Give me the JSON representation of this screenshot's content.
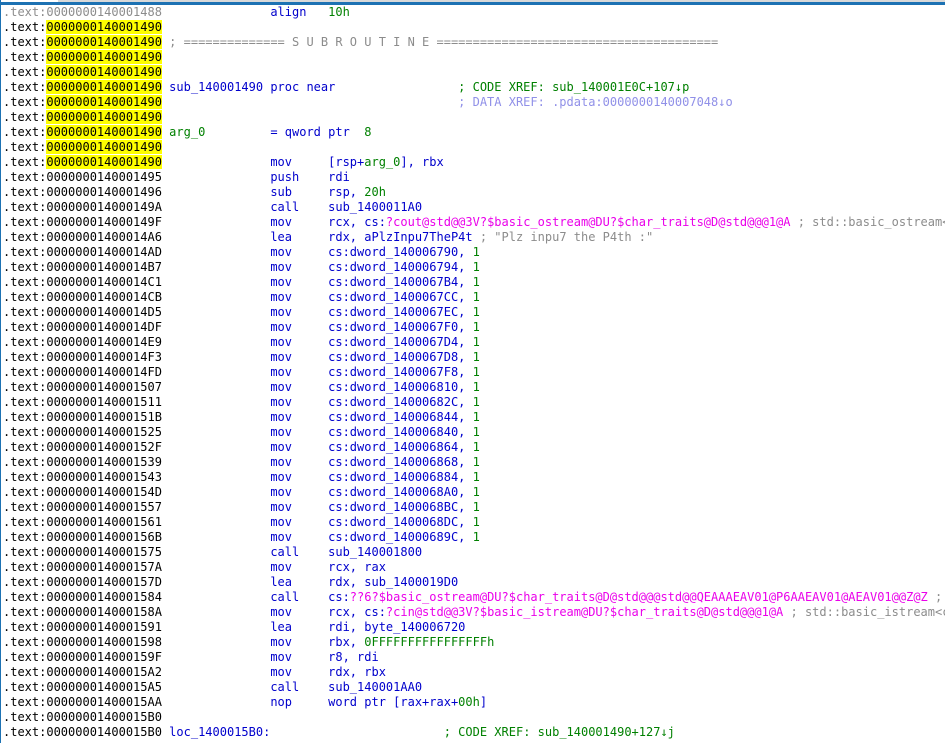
{
  "colors": {
    "focus_blue": "#1d72b3",
    "sliver_gray": "#d9d9d9",
    "addr_black": "#000000",
    "dim_gray": "#8c8c8c",
    "highlight_yellow": "#ffff00",
    "code_blue": "#0000cc",
    "number_green": "#008000",
    "import_magenta": "#ea00ea",
    "dataxref_lavender": "#9090e8"
  },
  "view": {
    "segment_name": ".text",
    "current_address": "0000000140001490",
    "function_name": "sub_140001490"
  },
  "listing": {
    "lines": [
      {
        "segs": [
          [
            "d",
            ".text:0000000140001488"
          ],
          [
            "b",
            "               align   "
          ],
          [
            "g",
            "10h"
          ]
        ]
      },
      {
        "segs": [
          [
            "k",
            ".text:"
          ],
          [
            "hl",
            "0000000140001490"
          ]
        ]
      },
      {
        "segs": [
          [
            "k",
            ".text:"
          ],
          [
            "hl",
            "0000000140001490"
          ],
          [
            "d",
            " ; ============== S U B R O U T I N E ======================================="
          ]
        ]
      },
      {
        "segs": [
          [
            "k",
            ".text:"
          ],
          [
            "hl",
            "0000000140001490"
          ]
        ]
      },
      {
        "segs": [
          [
            "k",
            ".text:"
          ],
          [
            "hl",
            "0000000140001490"
          ]
        ]
      },
      {
        "segs": [
          [
            "k",
            ".text:"
          ],
          [
            "hl",
            "0000000140001490"
          ],
          [
            "b",
            " sub_140001490 proc near"
          ],
          [
            "g",
            "                 ; CODE XREF: sub_140001E0C+107↓p"
          ]
        ]
      },
      {
        "segs": [
          [
            "k",
            ".text:"
          ],
          [
            "hl",
            "0000000140001490"
          ],
          [
            "cl",
            "                                         ; DATA XREF: .pdata:0000000140007048↓o"
          ]
        ]
      },
      {
        "segs": [
          [
            "k",
            ".text:"
          ],
          [
            "hl",
            "0000000140001490"
          ]
        ]
      },
      {
        "segs": [
          [
            "k",
            ".text:"
          ],
          [
            "hl",
            "0000000140001490"
          ],
          [
            "g",
            " arg_0"
          ],
          [
            "b",
            "         = qword ptr"
          ],
          [
            "g",
            "  8"
          ]
        ]
      },
      {
        "segs": [
          [
            "k",
            ".text:"
          ],
          [
            "hl",
            "0000000140001490"
          ]
        ]
      },
      {
        "segs": [
          [
            "k",
            ".text:"
          ],
          [
            "hl",
            "0000000140001490"
          ],
          [
            "b",
            "               mov     [rsp+"
          ],
          [
            "g",
            "arg_0"
          ],
          [
            "b",
            "], rbx"
          ]
        ]
      },
      {
        "segs": [
          [
            "k",
            ".text:0000000140001495"
          ],
          [
            "b",
            "               push    rdi"
          ]
        ]
      },
      {
        "segs": [
          [
            "k",
            ".text:0000000140001496"
          ],
          [
            "b",
            "               sub     rsp, "
          ],
          [
            "g",
            "20h"
          ]
        ]
      },
      {
        "segs": [
          [
            "k",
            ".text:000000014000149A"
          ],
          [
            "b",
            "               call    sub_1400011A0"
          ]
        ]
      },
      {
        "segs": [
          [
            "k",
            ".text:000000014000149F"
          ],
          [
            "b",
            "               mov     rcx, cs:"
          ],
          [
            "p",
            "?cout@std@@3V?$basic_ostream@DU?$char_traits@D@std@@@1@A"
          ],
          [
            "d",
            " ; std::basic_ostream<cha"
          ]
        ]
      },
      {
        "segs": [
          [
            "k",
            ".text:00000001400014A6"
          ],
          [
            "b",
            "               lea     rdx, aPlzInpu7TheP4t"
          ],
          [
            "d",
            " ; \"Plz inpu7 the P4th :\""
          ]
        ]
      },
      {
        "segs": [
          [
            "k",
            ".text:00000001400014AD"
          ],
          [
            "b",
            "               mov     cs:dword_140006790, "
          ],
          [
            "g",
            "1"
          ]
        ]
      },
      {
        "segs": [
          [
            "k",
            ".text:00000001400014B7"
          ],
          [
            "b",
            "               mov     cs:dword_140006794, "
          ],
          [
            "g",
            "1"
          ]
        ]
      },
      {
        "segs": [
          [
            "k",
            ".text:00000001400014C1"
          ],
          [
            "b",
            "               mov     cs:dword_1400067B4, "
          ],
          [
            "g",
            "1"
          ]
        ]
      },
      {
        "segs": [
          [
            "k",
            ".text:00000001400014CB"
          ],
          [
            "b",
            "               mov     cs:dword_1400067CC, "
          ],
          [
            "g",
            "1"
          ]
        ]
      },
      {
        "segs": [
          [
            "k",
            ".text:00000001400014D5"
          ],
          [
            "b",
            "               mov     cs:dword_1400067EC, "
          ],
          [
            "g",
            "1"
          ]
        ]
      },
      {
        "segs": [
          [
            "k",
            ".text:00000001400014DF"
          ],
          [
            "b",
            "               mov     cs:dword_1400067F0, "
          ],
          [
            "g",
            "1"
          ]
        ]
      },
      {
        "segs": [
          [
            "k",
            ".text:00000001400014E9"
          ],
          [
            "b",
            "               mov     cs:dword_1400067D4, "
          ],
          [
            "g",
            "1"
          ]
        ]
      },
      {
        "segs": [
          [
            "k",
            ".text:00000001400014F3"
          ],
          [
            "b",
            "               mov     cs:dword_1400067D8, "
          ],
          [
            "g",
            "1"
          ]
        ]
      },
      {
        "segs": [
          [
            "k",
            ".text:00000001400014FD"
          ],
          [
            "b",
            "               mov     cs:dword_1400067F8, "
          ],
          [
            "g",
            "1"
          ]
        ]
      },
      {
        "segs": [
          [
            "k",
            ".text:0000000140001507"
          ],
          [
            "b",
            "               mov     cs:dword_140006810, "
          ],
          [
            "g",
            "1"
          ]
        ]
      },
      {
        "segs": [
          [
            "k",
            ".text:0000000140001511"
          ],
          [
            "b",
            "               mov     cs:dword_14000682C, "
          ],
          [
            "g",
            "1"
          ]
        ]
      },
      {
        "segs": [
          [
            "k",
            ".text:000000014000151B"
          ],
          [
            "b",
            "               mov     cs:dword_140006844, "
          ],
          [
            "g",
            "1"
          ]
        ]
      },
      {
        "segs": [
          [
            "k",
            ".text:0000000140001525"
          ],
          [
            "b",
            "               mov     cs:dword_140006840, "
          ],
          [
            "g",
            "1"
          ]
        ]
      },
      {
        "segs": [
          [
            "k",
            ".text:000000014000152F"
          ],
          [
            "b",
            "               mov     cs:dword_140006864, "
          ],
          [
            "g",
            "1"
          ]
        ]
      },
      {
        "segs": [
          [
            "k",
            ".text:0000000140001539"
          ],
          [
            "b",
            "               mov     cs:dword_140006868, "
          ],
          [
            "g",
            "1"
          ]
        ]
      },
      {
        "segs": [
          [
            "k",
            ".text:0000000140001543"
          ],
          [
            "b",
            "               mov     cs:dword_140006884, "
          ],
          [
            "g",
            "1"
          ]
        ]
      },
      {
        "segs": [
          [
            "k",
            ".text:000000014000154D"
          ],
          [
            "b",
            "               mov     cs:dword_1400068A0, "
          ],
          [
            "g",
            "1"
          ]
        ]
      },
      {
        "segs": [
          [
            "k",
            ".text:0000000140001557"
          ],
          [
            "b",
            "               mov     cs:dword_1400068BC, "
          ],
          [
            "g",
            "1"
          ]
        ]
      },
      {
        "segs": [
          [
            "k",
            ".text:0000000140001561"
          ],
          [
            "b",
            "               mov     cs:dword_1400068DC, "
          ],
          [
            "g",
            "1"
          ]
        ]
      },
      {
        "segs": [
          [
            "k",
            ".text:000000014000156B"
          ],
          [
            "b",
            "               mov     cs:dword_14000689C, "
          ],
          [
            "g",
            "1"
          ]
        ]
      },
      {
        "segs": [
          [
            "k",
            ".text:0000000140001575"
          ],
          [
            "b",
            "               call    sub_140001800"
          ]
        ]
      },
      {
        "segs": [
          [
            "k",
            ".text:000000014000157A"
          ],
          [
            "b",
            "               mov     rcx, rax"
          ]
        ]
      },
      {
        "segs": [
          [
            "k",
            ".text:000000014000157D"
          ],
          [
            "b",
            "               lea     rdx, sub_1400019D0"
          ]
        ]
      },
      {
        "segs": [
          [
            "k",
            ".text:0000000140001584"
          ],
          [
            "b",
            "               call    cs:"
          ],
          [
            "p",
            "??6?$basic_ostream@DU?$char_traits@D@std@@@std@@QEAAAEAV01@P6AAEAV01@AEAV01@@Z@Z"
          ],
          [
            "d",
            " ; st"
          ]
        ]
      },
      {
        "segs": [
          [
            "k",
            ".text:000000014000158A"
          ],
          [
            "b",
            "               mov     rcx, cs:"
          ],
          [
            "p",
            "?cin@std@@3V?$basic_istream@DU?$char_traits@D@std@@@1@A"
          ],
          [
            "d",
            " ; std::basic_istream<cha"
          ]
        ]
      },
      {
        "segs": [
          [
            "k",
            ".text:0000000140001591"
          ],
          [
            "b",
            "               lea     rdi, byte_140006720"
          ]
        ]
      },
      {
        "segs": [
          [
            "k",
            ".text:0000000140001598"
          ],
          [
            "b",
            "               mov     rbx, "
          ],
          [
            "g",
            "0FFFFFFFFFFFFFFFFh"
          ]
        ]
      },
      {
        "segs": [
          [
            "k",
            ".text:000000014000159F"
          ],
          [
            "b",
            "               mov     r8, rdi"
          ]
        ]
      },
      {
        "segs": [
          [
            "k",
            ".text:00000001400015A2"
          ],
          [
            "b",
            "               mov     rdx, rbx"
          ]
        ]
      },
      {
        "segs": [
          [
            "k",
            ".text:00000001400015A5"
          ],
          [
            "b",
            "               call    sub_140001AA0"
          ]
        ]
      },
      {
        "segs": [
          [
            "k",
            ".text:00000001400015AA"
          ],
          [
            "b",
            "               nop     word ptr [rax+rax+"
          ],
          [
            "g",
            "00h"
          ],
          [
            "b",
            "]"
          ]
        ]
      },
      {
        "segs": [
          [
            "k",
            ".text:00000001400015B0"
          ]
        ]
      },
      {
        "segs": [
          [
            "k",
            ".text:00000001400015B0"
          ],
          [
            "b",
            " loc_1400015B0:"
          ],
          [
            "g",
            "                        ; CODE XREF: sub_140001490+127↓j"
          ]
        ]
      }
    ]
  }
}
